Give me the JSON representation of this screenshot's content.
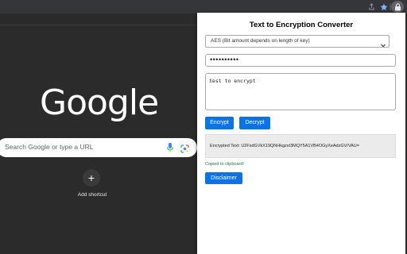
{
  "browser": {
    "share_icon": "share-icon",
    "bookmark_icon": "star-icon",
    "extension_icon": "lock-icon",
    "accent_color": "#1a73e8"
  },
  "new_tab": {
    "logo_text": "Google",
    "search_placeholder": "Search Google or type a URL",
    "add_shortcut_label": "Add shortcut",
    "add_shortcut_symbol": "+"
  },
  "popup": {
    "title": "Text to Encryption Converter",
    "algorithm_selected": "AES (Bit amount depends on length of key)",
    "key_value": "••••••••••",
    "plaintext_value": "test to encrypt",
    "encrypt_label": "Encrypt",
    "decrypt_label": "Decrypt",
    "result_text": "Encrypted Text: U2FsdGVkX19QNHkgzxt3MQY5A1VB4OGyXeAdzGV/VAU=",
    "copied_text": "Copied to clipboard!",
    "disclaimer_label": "Disclaimer",
    "button_color": "#0b73e3"
  }
}
